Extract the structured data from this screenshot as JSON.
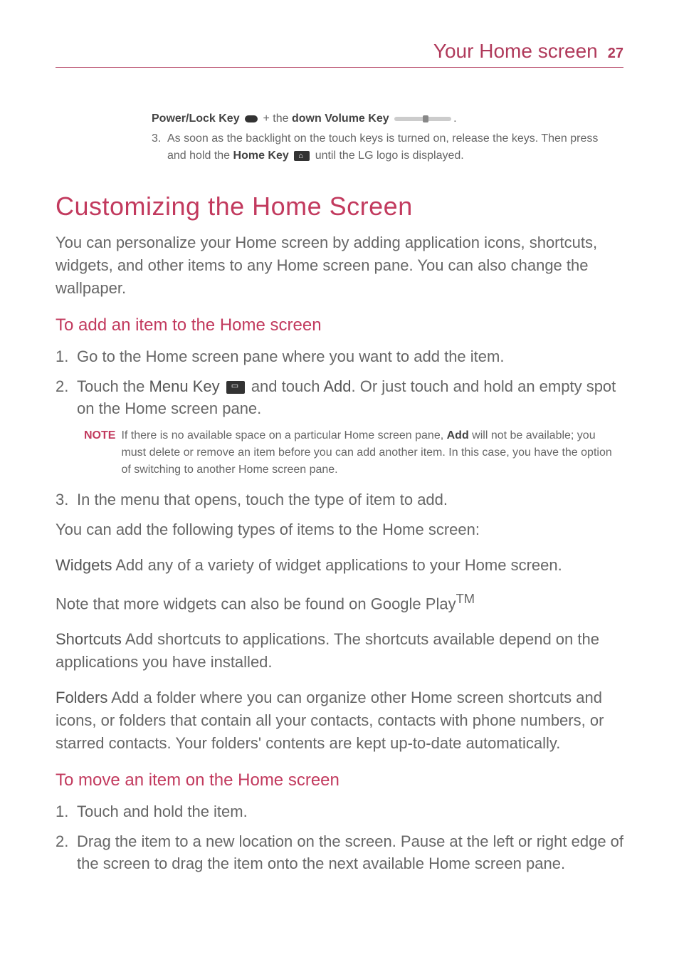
{
  "header": {
    "title": "Your Home screen",
    "page": "27"
  },
  "pre": {
    "line1a": "Power/Lock Key",
    "line1b": " + the ",
    "line1c": "down Volume Key",
    "line1d": ".",
    "step3num": "3.",
    "step3a": "As soon as the backlight on the touch keys is turned on, release the keys. Then press and hold the ",
    "step3b": "Home Key",
    "step3c": " until the LG logo is displayed."
  },
  "h1": "Customizing the Home Screen",
  "intro": "You can personalize your Home screen by adding application icons, shortcuts, widgets, and other items to any Home screen pane. You can also change the wallpaper.",
  "sub1": "To add an item to the Home screen",
  "s1_1n": "1.",
  "s1_1": "Go to the Home screen pane where you want to add the item.",
  "s1_2n": "2.",
  "s1_2a": "Touch the ",
  "s1_2b": "Menu Key",
  "s1_2c": " and touch ",
  "s1_2d": "Add",
  "s1_2e": ". Or just touch and hold an empty spot on the Home screen pane.",
  "note_label": "NOTE",
  "note_a": "If there is no available space on a particular Home screen pane, ",
  "note_b": "Add",
  "note_c": " will not be available; you must delete or remove an item before you can add another item. In this case, you have the option of switching to another Home screen pane.",
  "s1_3n": "3.",
  "s1_3": "In the menu that opens, touch the type of item to add.",
  "p_types": "You can add the following types of items to the Home screen:",
  "p_widgets_lead": "Widgets",
  "p_widgets_body": "  Add any of a variety of widget applications to your Home screen.",
  "p_widgets2a": "Note that more widgets can also be found on Google Play",
  "p_widgets2b": "TM",
  "p_short_lead": "Shortcuts",
  "p_short_body": "  Add shortcuts to applications. The shortcuts available depend on the applications you have installed.",
  "p_fold_lead": "Folders",
  "p_fold_body": "  Add a folder where you can organize other Home screen shortcuts and icons, or folders that contain all your contacts, contacts with phone numbers, or starred contacts. Your folders' contents are kept up-to-date automatically.",
  "sub2": "To move an item on the Home screen",
  "s2_1n": "1.",
  "s2_1": "Touch and hold the item.",
  "s2_2n": "2.",
  "s2_2": "Drag the item to a new location on the screen. Pause at the left or right edge of the screen to drag the item onto the next available Home screen pane."
}
